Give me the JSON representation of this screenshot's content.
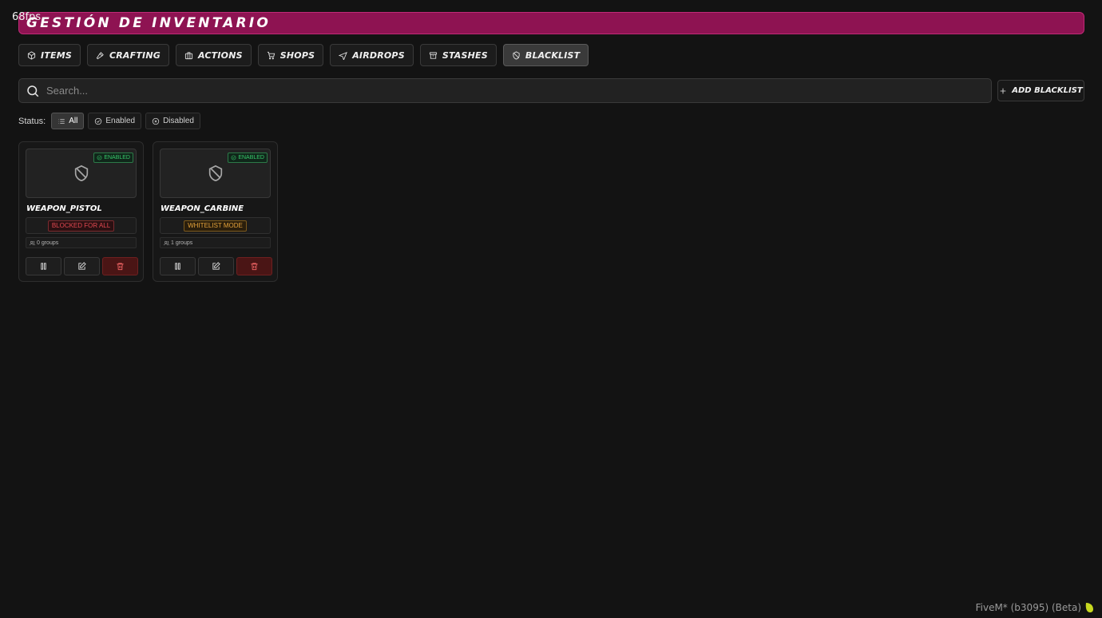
{
  "overlay": {
    "fps": "68fps"
  },
  "header": {
    "title": "Gestión de inventario"
  },
  "tabs": [
    {
      "label": "Items",
      "icon": "box-icon",
      "active": false
    },
    {
      "label": "Crafting",
      "icon": "hammer-icon",
      "active": false
    },
    {
      "label": "Actions",
      "icon": "briefcase-icon",
      "active": false
    },
    {
      "label": "Shops",
      "icon": "cart-icon",
      "active": false
    },
    {
      "label": "Airdrops",
      "icon": "plane-icon",
      "active": false
    },
    {
      "label": "Stashes",
      "icon": "archive-icon",
      "active": false
    },
    {
      "label": "Blacklist",
      "icon": "shield-off-icon",
      "active": true
    }
  ],
  "search": {
    "placeholder": "Search...",
    "value": ""
  },
  "add_button": {
    "label": "Add Blacklist"
  },
  "status_filter": {
    "label": "Status:",
    "options": [
      {
        "label": "All",
        "active": true
      },
      {
        "label": "Enabled",
        "active": false
      },
      {
        "label": "Disabled",
        "active": false
      }
    ]
  },
  "cards": [
    {
      "name": "WEAPON_PISTOL",
      "status": "Enabled",
      "mode": "Blocked for all",
      "mode_type": "blocked",
      "groups": "0 groups"
    },
    {
      "name": "WEAPON_CARBINE",
      "status": "Enabled",
      "mode": "Whitelist mode",
      "mode_type": "whitelist",
      "groups": "1 groups"
    }
  ],
  "footer": {
    "client": "FiveM* (b3095) (Beta)"
  },
  "colors": {
    "accent": "#8e1352",
    "enabled": "#37c96b",
    "blocked": "#e34850",
    "whitelist": "#e5a33a",
    "delete": "#4a1515"
  }
}
